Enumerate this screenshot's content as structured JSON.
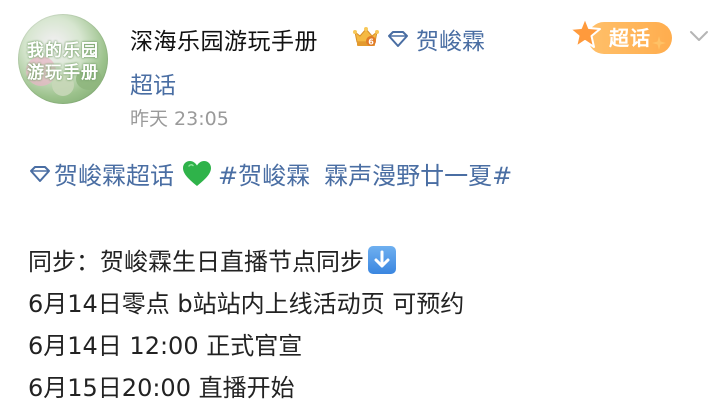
{
  "post": {
    "author": {
      "name": "深海乐园游玩手册",
      "avatar_text_line1": "我的乐园",
      "avatar_text_line2": "游玩手册"
    },
    "topic_prefix": "贺峻霖",
    "topic_suffix": "超话",
    "timestamp": "昨天 23:05",
    "badge_label": "超话",
    "tags": {
      "super_topic": "贺峻霖超话",
      "hashtag1": "#贺峻霖",
      "hashtag2": "霖声漫野廿一夏#"
    },
    "body": {
      "line1": "同步：贺峻霖生日直播节点同步",
      "line2": "6月14日零点 b站站内上线活动页 可预约",
      "line3": "6月14日 12:00 正式官宣",
      "line4": "6月15日20:00 直播开始"
    }
  },
  "icons": {
    "crown": "crown-badge-icon",
    "diamond": "super-topic-diamond-icon",
    "heart": "green-heart-emoji",
    "arrow": "down-arrow-emoji",
    "chevron": "chevron-down-icon"
  },
  "colors": {
    "link": "#4a6ea3",
    "timestamp": "#9a9a9a",
    "badge": "#ffad4e",
    "heart": "#2fb34a"
  }
}
